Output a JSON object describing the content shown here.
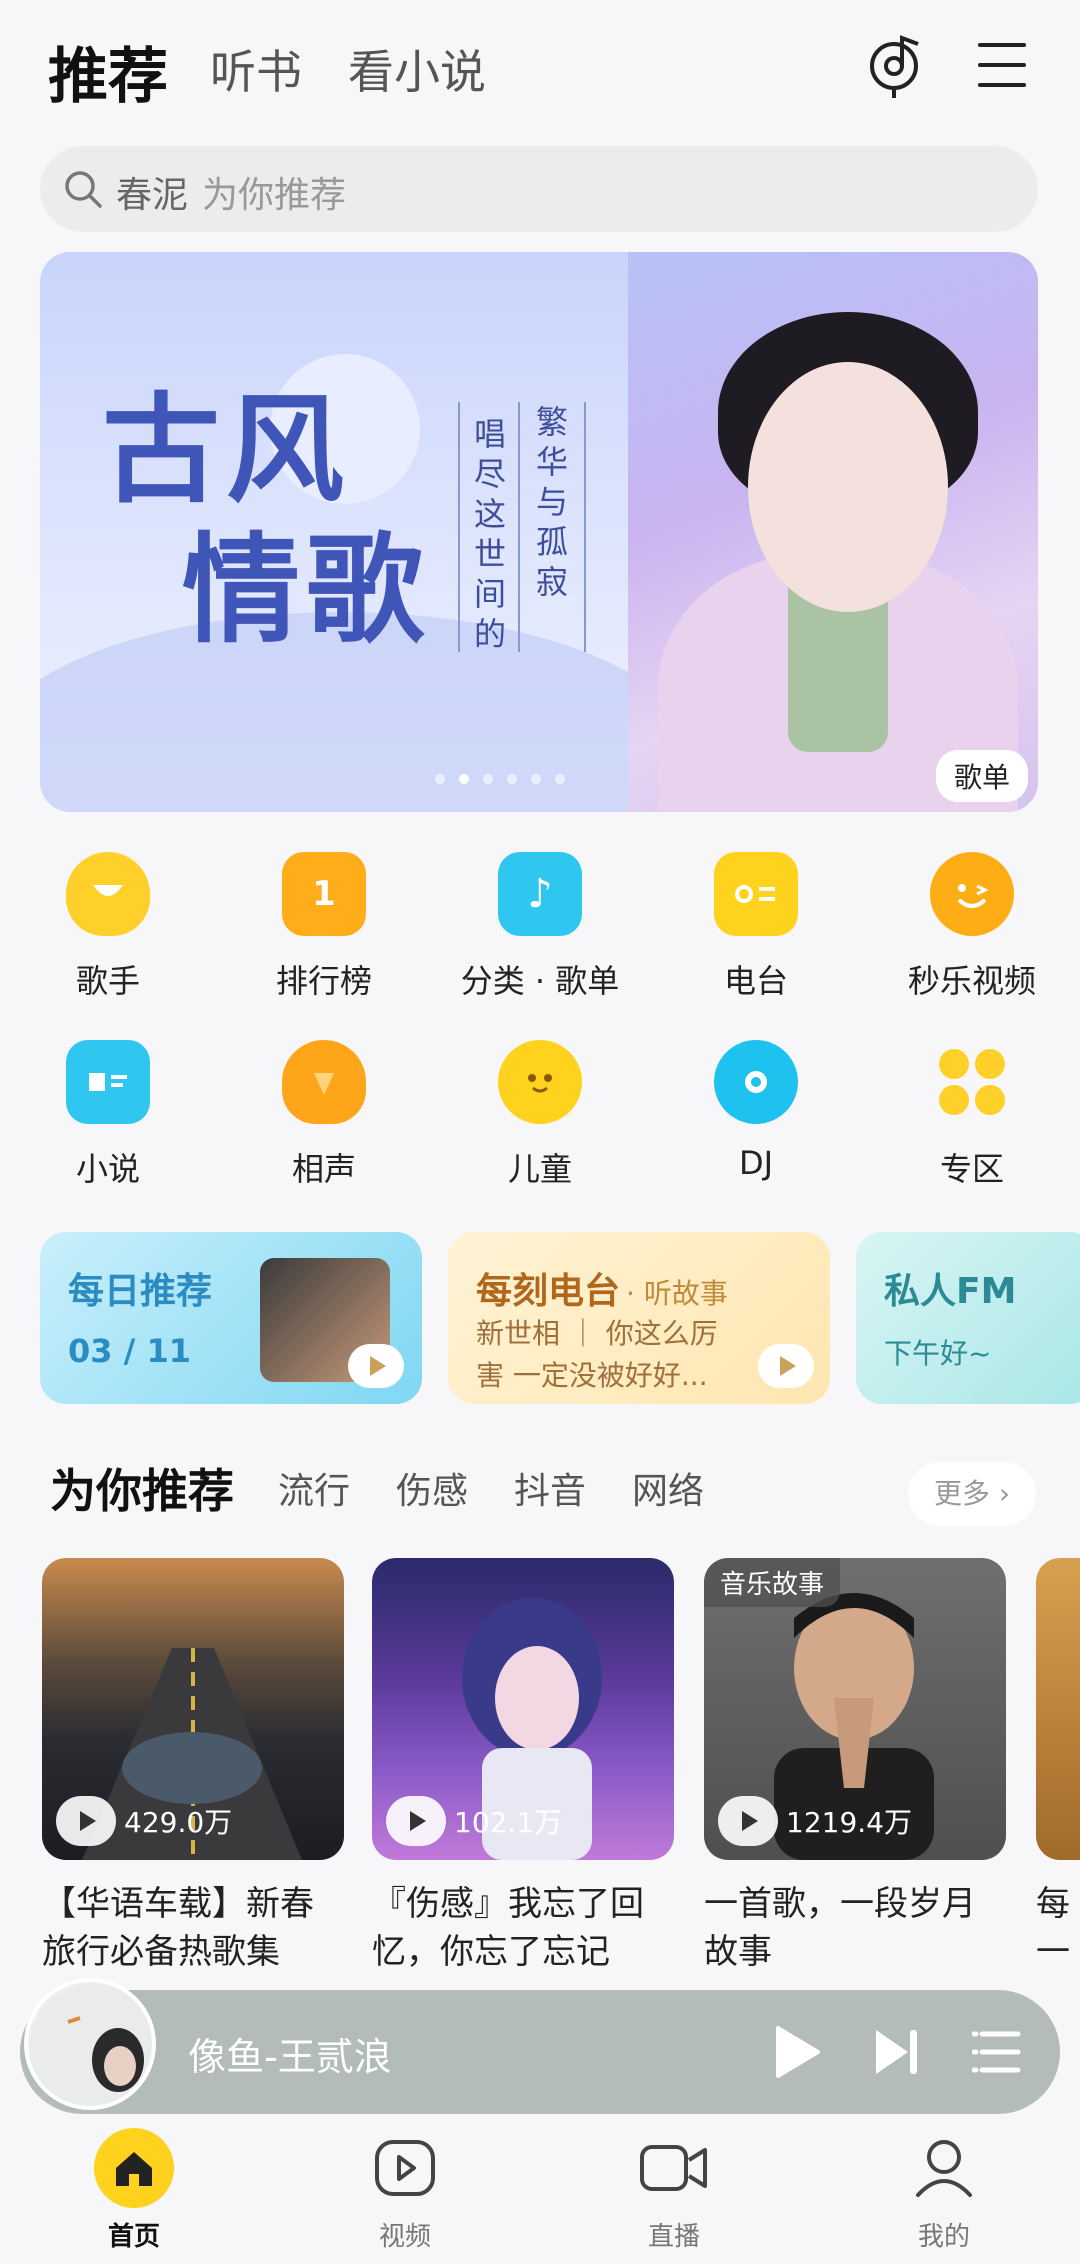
{
  "top_tabs": [
    {
      "label": "推荐",
      "active": true
    },
    {
      "label": "听书",
      "active": false
    },
    {
      "label": "看小说",
      "active": false
    }
  ],
  "icons": {
    "recognize": "music-recognize-icon",
    "menu": "hamburger-menu-icon"
  },
  "search": {
    "keyword": "春泥",
    "hint": "为你推荐"
  },
  "banner": {
    "title_line1": "古风",
    "title_line2": "情歌",
    "vertical_col1": "繁华与孤寂",
    "vertical_col2": "唱尽这世间的",
    "tag": "歌单"
  },
  "grid": [
    {
      "label": "歌手",
      "icon": "singer-icon",
      "color": "#ffcf2a"
    },
    {
      "label": "排行榜",
      "icon": "ranking-icon",
      "color": "#ffae1a"
    },
    {
      "label": "分类 · 歌单",
      "icon": "music-note-icon",
      "color": "#2fc7f0"
    },
    {
      "label": "电台",
      "icon": "radio-icon",
      "color": "#ffd21e"
    },
    {
      "label": "秒乐视频",
      "icon": "smile-video-icon",
      "color": "#ffad14"
    },
    {
      "label": "小说",
      "icon": "book-icon",
      "color": "#2fc7f0"
    },
    {
      "label": "相声",
      "icon": "fan-icon",
      "color": "#ffa51a"
    },
    {
      "label": "儿童",
      "icon": "kid-icon",
      "color": "#ffd21e"
    },
    {
      "label": "DJ",
      "icon": "disc-icon",
      "color": "#1ec2ef"
    },
    {
      "label": "专区",
      "icon": "zone-grid-icon",
      "color": "#ffcf2a"
    }
  ],
  "cards": {
    "daily": {
      "title": "每日推荐",
      "date": "03 / 11"
    },
    "radio": {
      "title": "每刻电台",
      "subtitle": "· 听故事",
      "desc_line1": "新世相 ｜ 你这么厉",
      "desc_line2": "害 一定没被好好..."
    },
    "fm": {
      "title": "私人FM",
      "desc": "下午好~"
    }
  },
  "section_tabs": [
    {
      "label": "为你推荐",
      "active": true
    },
    {
      "label": "流行",
      "active": false
    },
    {
      "label": "伤感",
      "active": false
    },
    {
      "label": "抖音",
      "active": false
    },
    {
      "label": "网络",
      "active": false
    }
  ],
  "more_label": "更多",
  "playlists": [
    {
      "plays": "429.0万",
      "title_line1": "【华语车载】新春",
      "title_line2": "旅行必备热歌集",
      "badge": ""
    },
    {
      "plays": "102.1万",
      "title_line1": "『伤感』我忘了回",
      "title_line2": "忆，你忘了忘记",
      "badge": ""
    },
    {
      "plays": "1219.4万",
      "title_line1": "一首歌，一段岁月",
      "title_line2": "故事",
      "badge": "音乐故事"
    },
    {
      "plays": "",
      "title_line1": "每一",
      "title_line2": "忆的",
      "badge": ""
    }
  ],
  "player": {
    "song": "像鱼-王贰浪"
  },
  "bottom_nav": [
    {
      "label": "首页",
      "icon": "home-icon",
      "active": true
    },
    {
      "label": "视频",
      "icon": "video-play-icon",
      "active": false
    },
    {
      "label": "直播",
      "icon": "live-camera-icon",
      "active": false
    },
    {
      "label": "我的",
      "icon": "profile-icon",
      "active": false
    }
  ]
}
